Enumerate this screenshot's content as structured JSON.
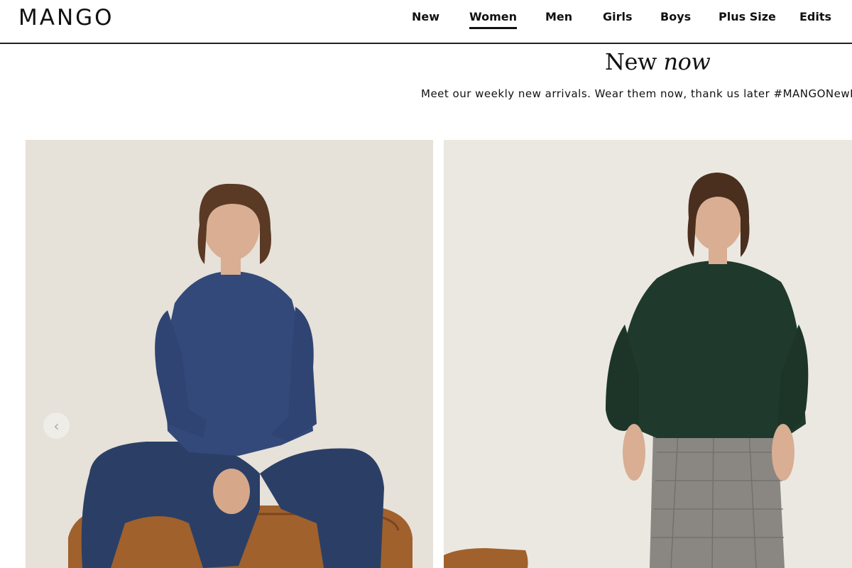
{
  "brand": {
    "logo_text": "MANGO"
  },
  "nav": {
    "items": [
      {
        "label": "New"
      },
      {
        "label": "Women",
        "active": true
      },
      {
        "label": "Men"
      },
      {
        "label": "Girls"
      },
      {
        "label": "Boys"
      },
      {
        "label": "Plus Size"
      },
      {
        "label": "Edits"
      }
    ]
  },
  "hero": {
    "title_plain": "New",
    "title_italic": "now",
    "subtitle": "Meet our weekly new arrivals. Wear them now, thank us later #MANGONewN"
  },
  "products": [
    {
      "alt": "Model in denim shirt and denim flared jeans sitting on a brown leather ottoman"
    },
    {
      "alt": "Model in dark green knit sweater and grey check skirt"
    }
  ],
  "carousel": {
    "prev_icon": "chevron-left-icon"
  },
  "colors": {
    "accent": "#111111",
    "background": "#ffffff"
  }
}
